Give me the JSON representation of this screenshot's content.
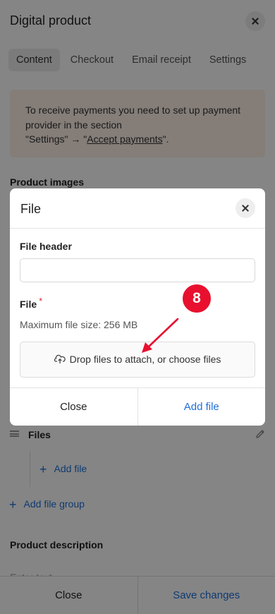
{
  "panel": {
    "title": "Digital product",
    "tabs": [
      "Content",
      "Checkout",
      "Email receipt",
      "Settings"
    ],
    "active_tab": "Content",
    "notice": {
      "line1": "To receive payments you need to set up payment provider in the section",
      "prefix": "\"Settings\" → \"",
      "link": "Accept payments",
      "suffix": "\"."
    },
    "product_images_title": "Product images",
    "file_group": {
      "name": "Files",
      "add_file": "Add file"
    },
    "add_file_group": "Add file group",
    "product_description_title": "Product description",
    "description_placeholder": "Enter text",
    "footer": {
      "close": "Close",
      "save": "Save changes"
    }
  },
  "modal": {
    "title": "File",
    "file_header_label": "File header",
    "file_header_value": "",
    "file_label": "File",
    "required_mark": "*",
    "max_size_hint": "Maximum file size: 256 MB",
    "dropzone_text": "Drop files to attach, or choose files",
    "footer": {
      "close": "Close",
      "add": "Add file"
    }
  },
  "annotation": {
    "step": "8",
    "color": "#e8102e"
  },
  "colors": {
    "accent": "#1e6fd9",
    "notice_bg": "#fdf0e6",
    "required": "#e0282e"
  },
  "icons": [
    "close-icon",
    "drag-handle-icon",
    "pencil-icon",
    "plus-icon",
    "upload-icon"
  ]
}
